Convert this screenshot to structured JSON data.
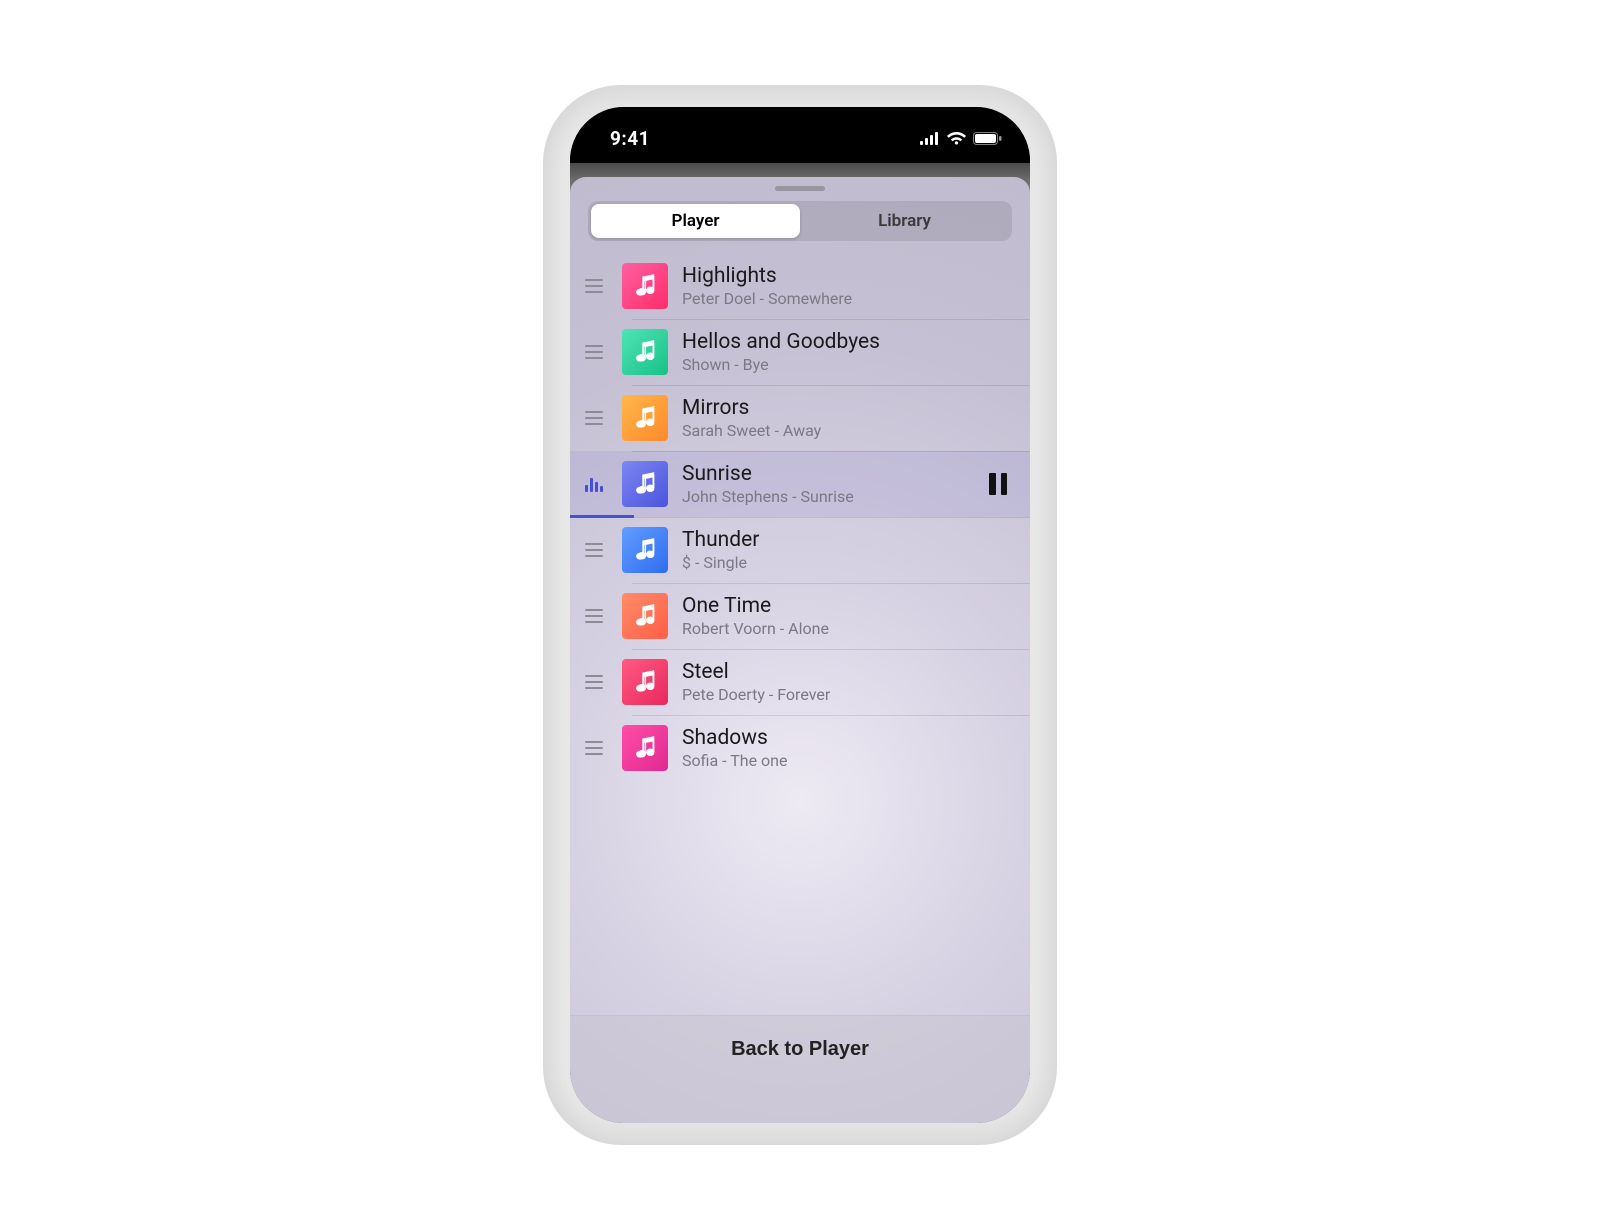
{
  "statusbar": {
    "time": "9:41"
  },
  "tabs": {
    "player": "Player",
    "library": "Library",
    "selected": "player"
  },
  "songs": [
    {
      "title": "Highlights",
      "subtitle": "Peter Doel - Somewhere",
      "art": "g-pink",
      "playing": false
    },
    {
      "title": "Hellos and Goodbyes",
      "subtitle": "Shown - Bye",
      "art": "g-teal",
      "playing": false
    },
    {
      "title": "Mirrors",
      "subtitle": "Sarah Sweet - Away",
      "art": "g-orange",
      "playing": false
    },
    {
      "title": "Sunrise",
      "subtitle": "John Stephens - Sunrise",
      "art": "g-indigo",
      "playing": true,
      "progress_pct": 14
    },
    {
      "title": "Thunder",
      "subtitle": "$ - Single",
      "art": "g-blue",
      "playing": false
    },
    {
      "title": "One Time",
      "subtitle": "Robert Voorn - Alone",
      "art": "g-coral",
      "playing": false
    },
    {
      "title": "Steel",
      "subtitle": "Pete Doerty - Forever",
      "art": "g-red",
      "playing": false
    },
    {
      "title": "Shadows",
      "subtitle": "Sofia - The one",
      "art": "g-magenta",
      "playing": false
    }
  ],
  "footer": {
    "back_label": "Back to Player"
  },
  "colors": {
    "accent": "#4450d8"
  }
}
